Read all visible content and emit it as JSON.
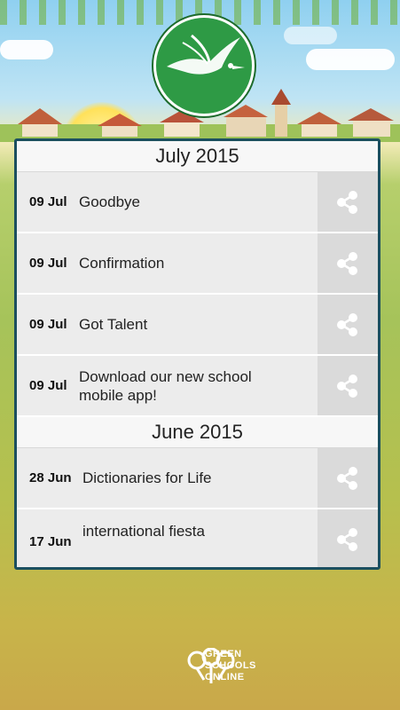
{
  "app": {
    "brand_line1": "GREEN",
    "brand_line2": "SCHOOLS",
    "brand_line3": "ONLINE"
  },
  "colors": {
    "panel_border": "#1b4f5f",
    "logo_green": "#2e9a45",
    "row_bg": "#ececec",
    "share_bg": "#dadada"
  },
  "sections": [
    {
      "month": "July 2015",
      "items": [
        {
          "date": "09 Jul",
          "title": "Goodbye",
          "icon": "share-icon"
        },
        {
          "date": "09 Jul",
          "title": "Confirmation",
          "icon": "share-icon"
        },
        {
          "date": "09 Jul",
          "title": "Got Talent",
          "icon": "share-icon"
        },
        {
          "date": "09 Jul",
          "title": "Download our new school mobile app!",
          "icon": "share-icon"
        }
      ]
    },
    {
      "month": "June 2015",
      "items": [
        {
          "date": "28 Jun",
          "title": "Dictionaries for Life",
          "icon": "share-icon"
        },
        {
          "date": "17 Jun",
          "title": "international fiesta",
          "icon": "share-icon"
        }
      ]
    }
  ]
}
